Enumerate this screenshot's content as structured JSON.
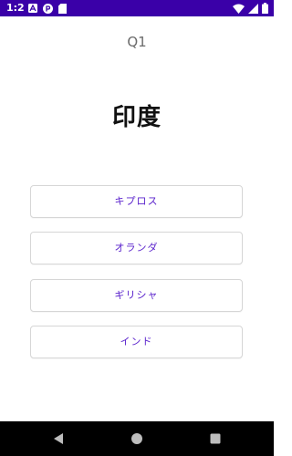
{
  "status_bar": {
    "time": "1:2",
    "background_color": "#3a00a8",
    "left_icons": [
      "a-notification-icon",
      "p-notification-icon",
      "sd-card-icon"
    ],
    "right_icons": [
      "wifi-icon",
      "cell-signal-icon",
      "battery-icon"
    ]
  },
  "quiz": {
    "question_number": "Q1",
    "question": "印度",
    "answers": [
      "キプロス",
      "オランダ",
      "ギリシャ",
      "インド"
    ]
  },
  "colors": {
    "accent": "#5a22cc",
    "button_border": "#d6d6d6"
  },
  "nav_bar": {
    "icons": [
      "back-icon",
      "home-icon",
      "recents-icon"
    ]
  }
}
